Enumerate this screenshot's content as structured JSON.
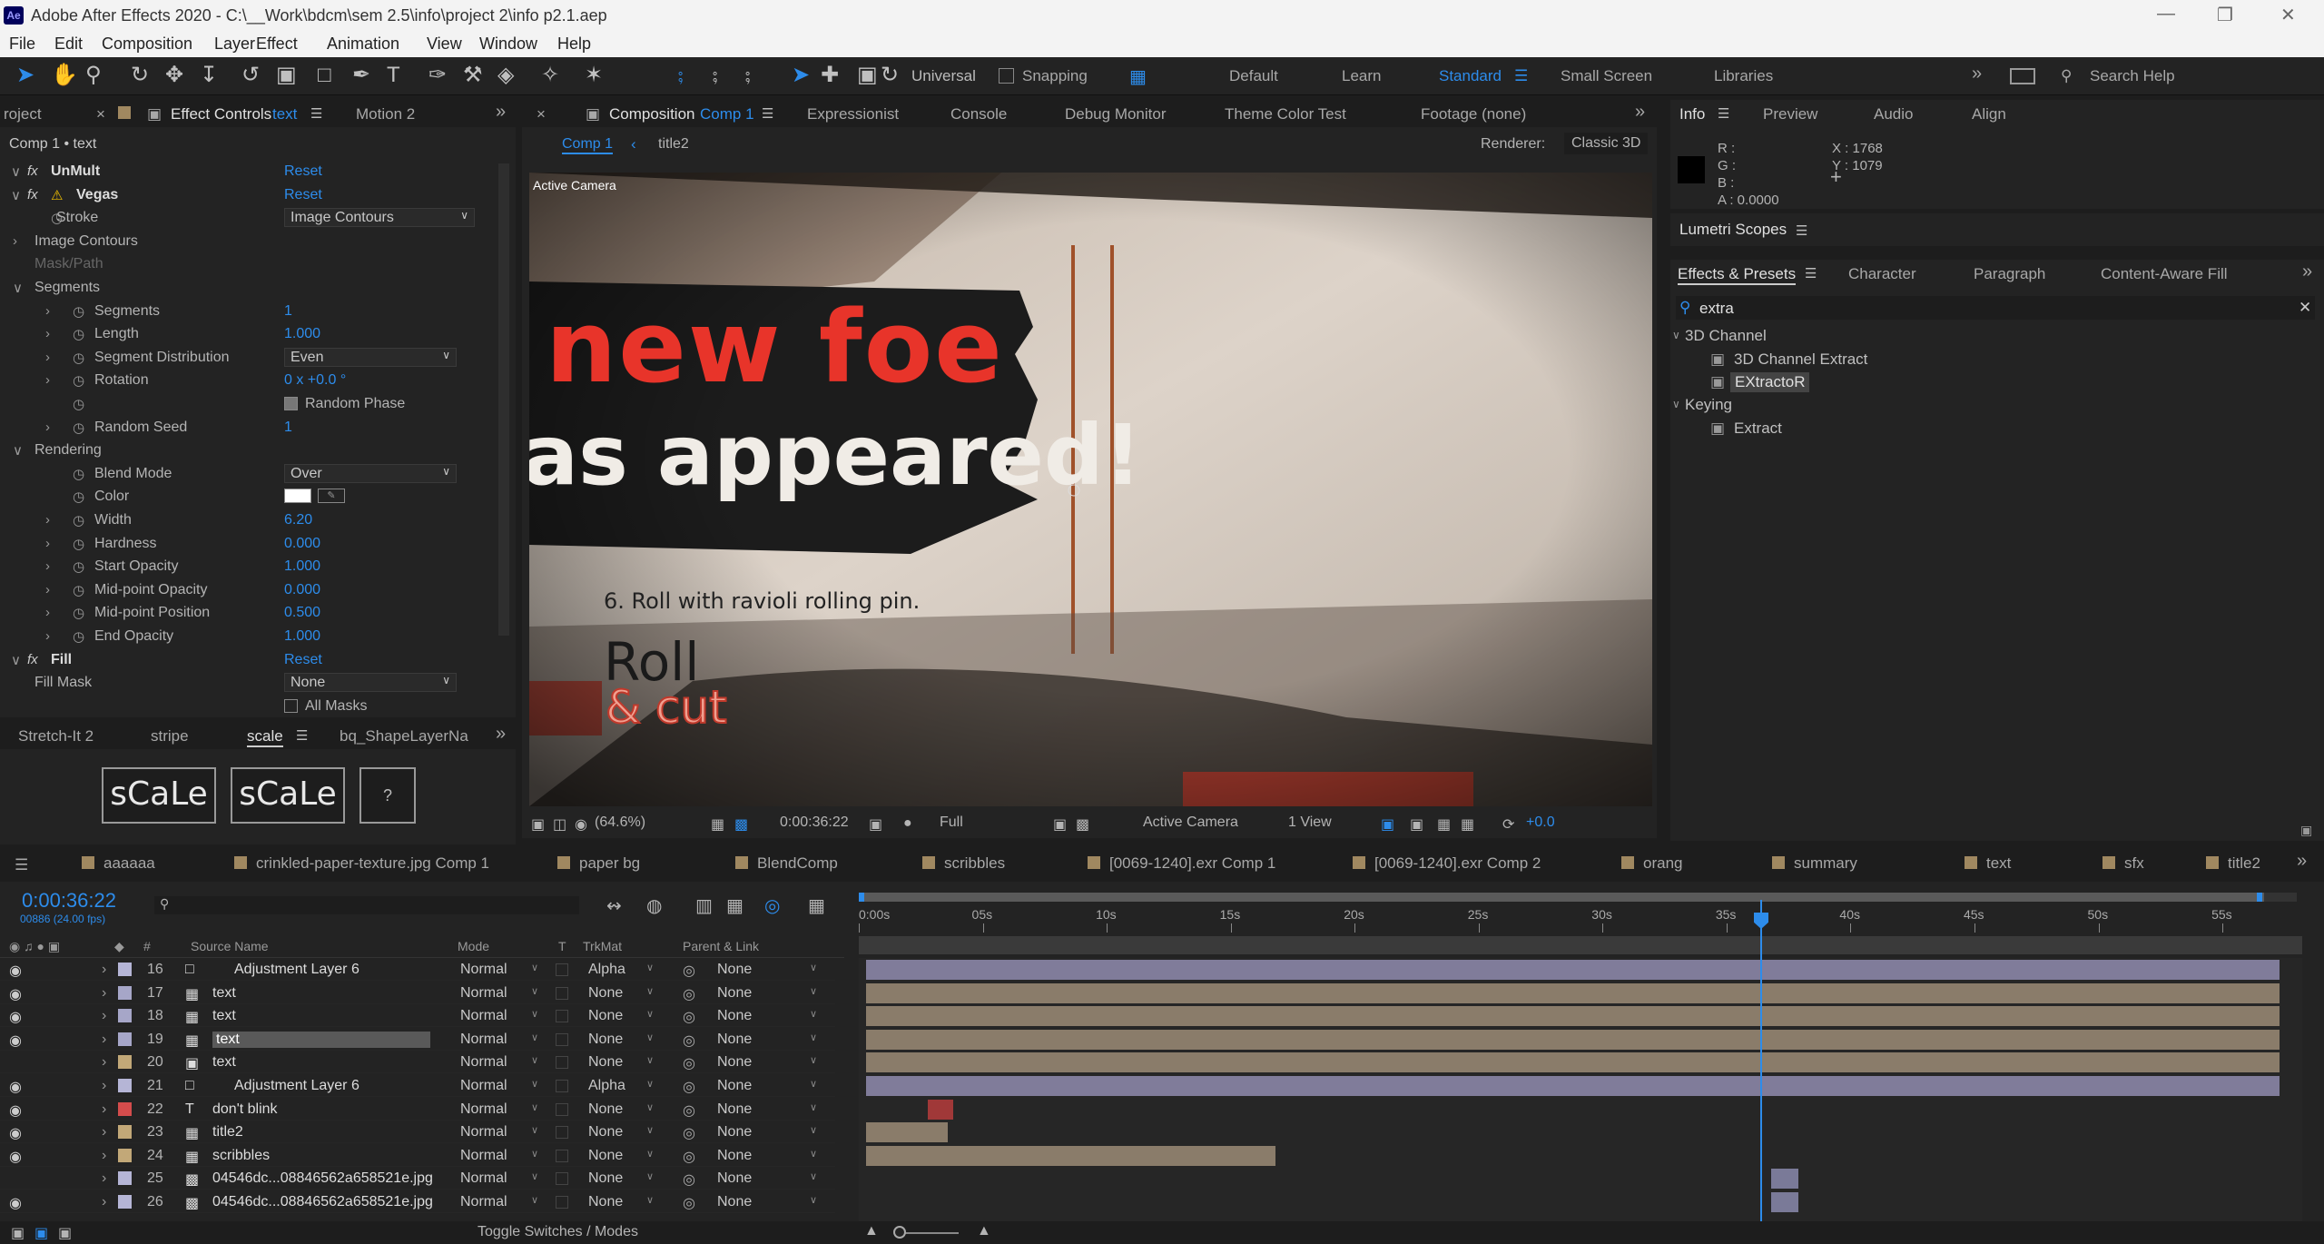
{
  "app": {
    "title": "Adobe After Effects 2020 - C:\\__Work\\bdcm\\sem 2.5\\info\\project 2\\info p2.1.aep",
    "logo": "Ae"
  },
  "menu": [
    "File",
    "Edit",
    "Composition",
    "Layer",
    "Effect",
    "Animation",
    "View",
    "Window",
    "Help"
  ],
  "toolbar": {
    "universal": "Universal",
    "snapping": "Snapping",
    "workspaces": [
      "Default",
      "Learn",
      "Standard",
      "Small Screen",
      "Libraries"
    ],
    "search_placeholder": "Search Help"
  },
  "effect_controls": {
    "tab_project": "roject",
    "tab_label": "Effect Controls",
    "tab_layer": "text",
    "tab_motion": "Motion 2",
    "breadcrumb": "Comp 1 • text",
    "rows": [
      {
        "label": "UnMult",
        "value": "Reset"
      },
      {
        "label": "Vegas",
        "value": "Reset"
      },
      {
        "label": "Stroke",
        "value": "Image Contours"
      },
      {
        "label": "Image Contours",
        "value": ""
      },
      {
        "label": "Mask/Path",
        "value": ""
      },
      {
        "label": "Segments",
        "value": ""
      },
      {
        "label": "Segments",
        "value": "1"
      },
      {
        "label": "Length",
        "value": "1.000"
      },
      {
        "label": "Segment Distribution",
        "value": "Even"
      },
      {
        "label": "Rotation",
        "value": "0 x +0.0 °"
      },
      {
        "label": "",
        "value": "Random Phase"
      },
      {
        "label": "Random Seed",
        "value": "1"
      },
      {
        "label": "Rendering",
        "value": ""
      },
      {
        "label": "Blend Mode",
        "value": "Over"
      },
      {
        "label": "Color",
        "value": ""
      },
      {
        "label": "Width",
        "value": "6.20"
      },
      {
        "label": "Hardness",
        "value": "0.000"
      },
      {
        "label": "Start Opacity",
        "value": "1.000"
      },
      {
        "label": "Mid-point Opacity",
        "value": "0.000"
      },
      {
        "label": "Mid-point Position",
        "value": "0.500"
      },
      {
        "label": "End Opacity",
        "value": "1.000"
      },
      {
        "label": "Fill",
        "value": "Reset"
      },
      {
        "label": "Fill Mask",
        "value": "None"
      },
      {
        "label": "",
        "value": "All Masks"
      }
    ]
  },
  "scripts": {
    "tabs": [
      "Stretch-It 2",
      "stripe",
      "scale",
      "bq_ShapeLayerNa"
    ],
    "buttons": [
      "sCaLe",
      "sCaLe",
      "?"
    ]
  },
  "composition": {
    "tab_label": "Composition",
    "comp_name": "Comp 1",
    "tabs": [
      "Expressionist",
      "Console",
      "Debug Monitor",
      "Theme Color Test",
      "Footage (none)"
    ],
    "breadcrumb": [
      "Comp 1",
      "title2"
    ],
    "renderer_label": "Renderer:",
    "renderer": "Classic 3D",
    "active_camera_label": "Active Camera",
    "viewer_text": {
      "line1": "new foe",
      "line2": "as appeared!",
      "step": "6. Roll with ravioli rolling pin.",
      "roll": "Roll",
      "cut": "& cut"
    },
    "footer": {
      "zoom": "(64.6%)",
      "timecode": "0:00:36:22",
      "resolution": "Full",
      "camera": "Active Camera",
      "views": "1 View",
      "exposure": "+0.0"
    }
  },
  "info": {
    "tabs": [
      "Info",
      "Preview",
      "Audio",
      "Align"
    ],
    "r": "R :",
    "g": "G :",
    "b": "B :",
    "a": "A : 0.0000",
    "x": "X : 1768",
    "y": "Y : 1079"
  },
  "lumetri": {
    "title": "Lumetri Scopes"
  },
  "effects_presets": {
    "tabs": [
      "Effects & Presets",
      "Character",
      "Paragraph",
      "Content-Aware Fill"
    ],
    "search": "extra",
    "groups": [
      {
        "name": "3D Channel",
        "items": [
          "3D Channel Extract",
          "EXtractoR"
        ]
      },
      {
        "name": "Keying",
        "items": [
          "Extract"
        ]
      }
    ]
  },
  "timeline": {
    "tabs": [
      "aaaaaa",
      "crinkled-paper-texture.jpg Comp 1",
      "paper bg",
      "BlendComp",
      "scribbles",
      "[0069-1240].exr Comp 1",
      "[0069-1240].exr Comp 2",
      "orang",
      "summary",
      "text",
      "sfx",
      "title2"
    ],
    "timecode": "0:00:36:22",
    "frame_info": "00886 (24.00 fps)",
    "headers": {
      "num": "#",
      "source": "Source Name",
      "mode": "Mode",
      "t": "T",
      "trkmat": "TrkMat",
      "parent": "Parent & Link"
    },
    "ruler": [
      "0:00s",
      "05s",
      "10s",
      "15s",
      "20s",
      "25s",
      "30s",
      "35s",
      "40s",
      "45s",
      "50s",
      "55s"
    ],
    "toggle": "Toggle Switches / Modes",
    "layers": [
      {
        "num": "16",
        "name": "Adjustment Layer 6",
        "mode": "Normal",
        "trkmat": "Alpha",
        "parent": "None",
        "color": "#b5b5d6",
        "start": 0,
        "end": 57,
        "icon": "adj"
      },
      {
        "num": "17",
        "name": "text",
        "mode": "Normal",
        "trkmat": "None",
        "parent": "None",
        "color": "#a6a6c8",
        "start": 0,
        "end": 57,
        "icon": "comp"
      },
      {
        "num": "18",
        "name": "text",
        "mode": "Normal",
        "trkmat": "None",
        "parent": "None",
        "color": "#a6a6c8",
        "start": 0,
        "end": 57,
        "icon": "comp"
      },
      {
        "num": "19",
        "name": "text",
        "mode": "Normal",
        "trkmat": "None",
        "parent": "None",
        "color": "#a6a6c8",
        "start": 0,
        "end": 57,
        "icon": "comp",
        "selected": true
      },
      {
        "num": "20",
        "name": "text",
        "mode": "Normal",
        "trkmat": "None",
        "parent": "None",
        "color": "#c2a878",
        "start": 0,
        "end": 57,
        "icon": "null"
      },
      {
        "num": "21",
        "name": "Adjustment Layer 6",
        "mode": "Normal",
        "trkmat": "Alpha",
        "parent": "None",
        "color": "#b5b5d6",
        "start": 0,
        "end": 57,
        "icon": "adj"
      },
      {
        "num": "22",
        "name": "don't blink",
        "mode": "Normal",
        "trkmat": "None",
        "parent": "None",
        "color": "#d44c4c",
        "start": 2.5,
        "end": 3.5,
        "icon": "type"
      },
      {
        "num": "23",
        "name": "title2",
        "mode": "Normal",
        "trkmat": "None",
        "parent": "None",
        "color": "#c2a878",
        "start": 0,
        "end": 3.3,
        "icon": "comp"
      },
      {
        "num": "24",
        "name": "scribbles",
        "mode": "Normal",
        "trkmat": "None",
        "parent": "None",
        "color": "#c2a878",
        "start": 0,
        "end": 16.5,
        "icon": "comp"
      },
      {
        "num": "25",
        "name": "04546dc...08846562a658521e.jpg",
        "mode": "Normal",
        "trkmat": "None",
        "parent": "None",
        "color": "#b5b5d6",
        "start": 36.5,
        "end": 37.6,
        "icon": "img"
      },
      {
        "num": "26",
        "name": "04546dc...08846562a658521e.jpg",
        "mode": "Normal",
        "trkmat": "None",
        "parent": "None",
        "color": "#b5b5d6",
        "start": 36.5,
        "end": 37.6,
        "icon": "img"
      }
    ]
  },
  "colors": {
    "accent": "#2d8ceb",
    "panel": "#232323",
    "bg": "#1d1d1d",
    "headline": "#e8342a"
  }
}
